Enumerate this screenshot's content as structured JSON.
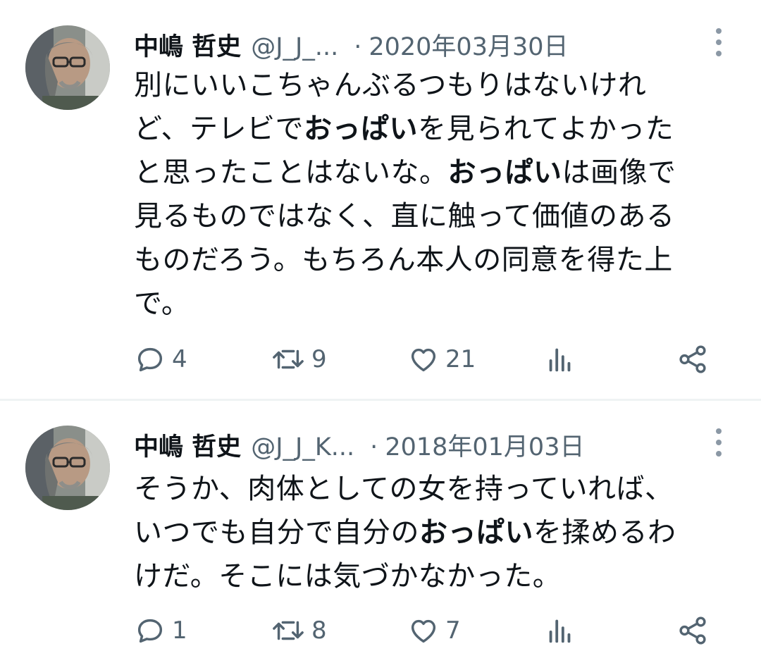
{
  "tweets": [
    {
      "author_name": "中嶋 哲史",
      "handle": "@J_J_...",
      "separator": "·",
      "date": "2020年03月30日",
      "text_lines": [
        [
          {
            "t": "別にいいこちゃんぶるつもりはないけれ",
            "b": false
          }
        ],
        [
          {
            "t": "ど、テレビで",
            "b": false
          },
          {
            "t": "おっぱい",
            "b": true
          },
          {
            "t": "を見られてよかった",
            "b": false
          }
        ],
        [
          {
            "t": "と思ったことはないな。",
            "b": false
          },
          {
            "t": "おっぱい",
            "b": true
          },
          {
            "t": "は画像で",
            "b": false
          }
        ],
        [
          {
            "t": "見るものではなく、直に触って価値のある",
            "b": false
          }
        ],
        [
          {
            "t": "ものだろう。もちろん本人の同意を得た上",
            "b": false
          }
        ],
        [
          {
            "t": "で。",
            "b": false
          }
        ]
      ],
      "replies": "4",
      "retweets": "9",
      "likes": "21",
      "icons": [
        "avatar",
        "more-vertical-icon",
        "reply-icon",
        "retweet-icon",
        "like-icon",
        "views-icon",
        "share-icon"
      ]
    },
    {
      "author_name": "中嶋 哲史",
      "handle": "@J_J_K...",
      "separator": "·",
      "date": "2018年01月03日",
      "text_lines": [
        [
          {
            "t": "そうか、肉体としての女を持っていれば、",
            "b": false
          }
        ],
        [
          {
            "t": "いつでも自分で自分の",
            "b": false
          },
          {
            "t": "おっぱい",
            "b": true
          },
          {
            "t": "を揉めるわ",
            "b": false
          }
        ],
        [
          {
            "t": "けだ。そこには気づかなかった。",
            "b": false
          }
        ]
      ],
      "replies": "1",
      "retweets": "8",
      "likes": "7",
      "icons": [
        "avatar",
        "more-vertical-icon",
        "reply-icon",
        "retweet-icon",
        "like-icon",
        "views-icon",
        "share-icon"
      ]
    }
  ],
  "colors": {
    "text": "#0f1419",
    "secondary": "#536471",
    "divider": "#eff3f4",
    "icon": "#8b98a5"
  }
}
